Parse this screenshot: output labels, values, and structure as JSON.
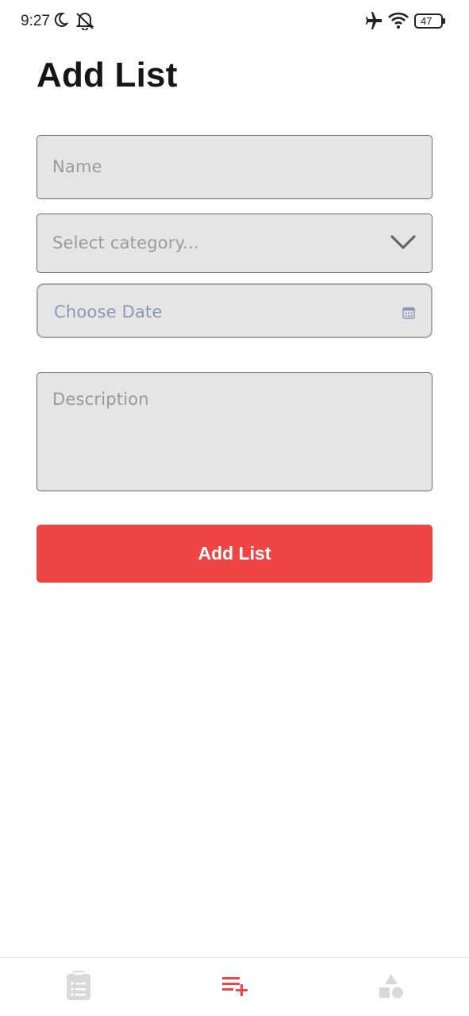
{
  "status_bar": {
    "time": "9:27",
    "battery": "47",
    "icons": [
      "moon-icon",
      "bell-off-icon",
      "airplane-icon",
      "wifi-icon",
      "battery-icon"
    ]
  },
  "header": {
    "title": "Add List"
  },
  "form": {
    "name": {
      "placeholder": "Name"
    },
    "category": {
      "placeholder": "Select category..."
    },
    "date": {
      "placeholder": "Choose Date"
    },
    "description": {
      "placeholder": "Description"
    },
    "submit_label": "Add List"
  },
  "tab_bar": {
    "items": [
      {
        "icon": "clipboard-list-icon",
        "active": false
      },
      {
        "icon": "playlist-add-icon",
        "active": true
      },
      {
        "icon": "shapes-icon",
        "active": false
      }
    ]
  },
  "colors": {
    "accent": "#ef4444",
    "field_background": "#e5e5e5",
    "placeholder": "#9a9a9a",
    "inactive_icon": "#d9d9d9"
  }
}
